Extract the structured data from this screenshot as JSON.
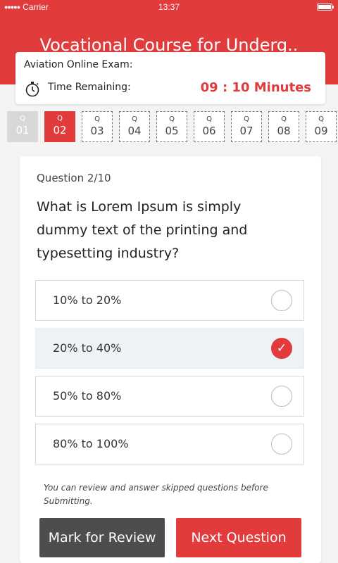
{
  "status_bar": {
    "carrier": "Carrier",
    "time": "13:37",
    "signal": "●●●●●"
  },
  "header": {
    "title": "Vocational Course for Underg..",
    "exam_name": "Aviation Online Exam:",
    "timer_label": "Time Remaining:",
    "timer_value": "09 : 10 Minutes"
  },
  "question_tabs": [
    {
      "q": "Q",
      "num": "01",
      "state": "done"
    },
    {
      "q": "Q",
      "num": "02",
      "state": "active"
    },
    {
      "q": "Q",
      "num": "03",
      "state": "pending"
    },
    {
      "q": "Q",
      "num": "04",
      "state": "pending"
    },
    {
      "q": "Q",
      "num": "05",
      "state": "pending"
    },
    {
      "q": "Q",
      "num": "06",
      "state": "pending"
    },
    {
      "q": "Q",
      "num": "07",
      "state": "pending"
    },
    {
      "q": "Q",
      "num": "08",
      "state": "pending"
    },
    {
      "q": "Q",
      "num": "09",
      "state": "pending"
    }
  ],
  "question": {
    "number": "Question 2/10",
    "text": "What is Lorem Ipsum is simply dummy text of the printing and typesetting industry?",
    "options": [
      {
        "label": "10% to 20%",
        "selected": false
      },
      {
        "label": "20% to 40%",
        "selected": true
      },
      {
        "label": "50% to 80%",
        "selected": false
      },
      {
        "label": "80% to 100%",
        "selected": false
      }
    ],
    "note": "You can review and answer skipped questions before Submitting."
  },
  "actions": {
    "review_label": "Mark for Review",
    "next_label": "Next Question"
  },
  "colors": {
    "accent": "#e23b3b",
    "dark_button": "#4d4d4d",
    "selected_bg": "#edf2f7"
  }
}
